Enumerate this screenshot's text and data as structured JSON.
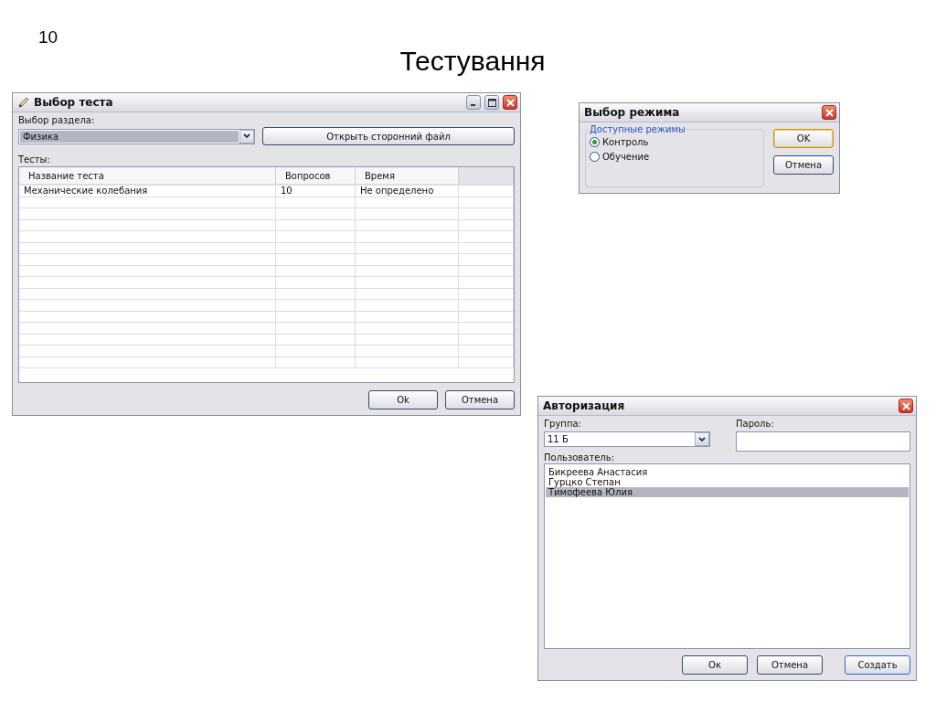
{
  "slide": {
    "number": "10",
    "title": "Тестування"
  },
  "test_window": {
    "title": "Выбор теста",
    "section_label": "Выбор раздела:",
    "section_value": "Физика",
    "open_file_button": "Открыть сторонний файл",
    "tests_label": "Тесты:",
    "table": {
      "columns": [
        "Название теста",
        "Вопросов",
        "Время"
      ],
      "rows": [
        [
          "Механические колебания",
          "10",
          "Не определено"
        ]
      ]
    },
    "buttons": [
      "Ok",
      "Отмена"
    ]
  },
  "mode_window": {
    "title": "Выбор режима",
    "group_label": "Доступные режимы",
    "modes": [
      {
        "label": "Контроль",
        "selected": true
      },
      {
        "label": "Обучение",
        "selected": false
      }
    ],
    "buttons": [
      "OK",
      "Отмена"
    ]
  },
  "auth_window": {
    "title": "Авторизация",
    "group_label": "Группа:",
    "group_value": "11 Б",
    "password_label": "Пароль:",
    "user_label": "Пользователь:",
    "users": [
      {
        "name": "Бикреева Анастасия",
        "selected": false
      },
      {
        "name": "Гурцко Степан",
        "selected": false
      },
      {
        "name": "Тимофеева Юлия",
        "selected": true
      }
    ],
    "buttons": [
      "Ок",
      "Отмена",
      "Создать"
    ]
  }
}
